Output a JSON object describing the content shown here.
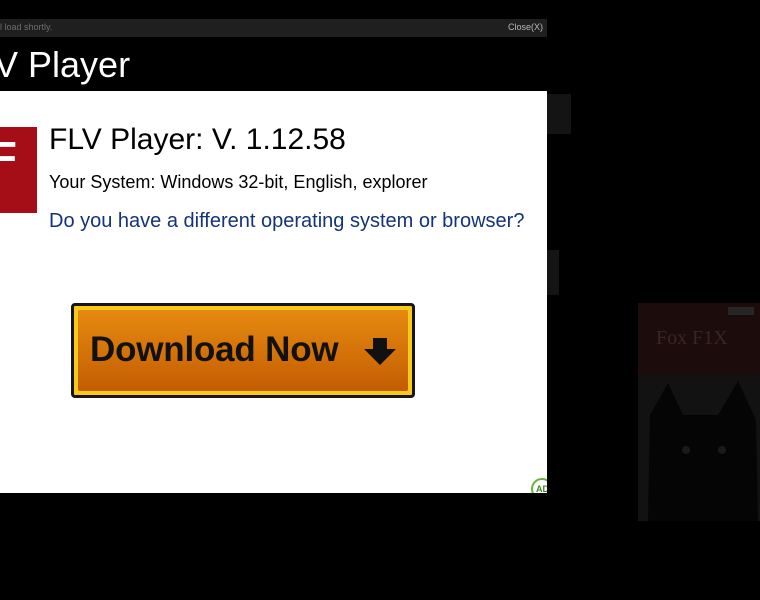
{
  "overlay": {
    "loading_text": "l load shortly.",
    "close_label": "Close(X)",
    "title": "V Player"
  },
  "dialog": {
    "icon_letter": "F",
    "headline": "FLV Player: V. 1.12.58",
    "system_info": "Your System: Windows 32-bit, English, explorer",
    "other_os_link": "Do you have a different operating system or browser?",
    "download_button_label": "Download Now",
    "ad_badge": "AD"
  },
  "background": {
    "thumbnail_title": "Fox F1X"
  },
  "colors": {
    "link_blue": "#13337a",
    "button_orange": "#d97a0a",
    "button_border": "#f8c81a",
    "icon_red": "#a50e16"
  },
  "icons": [
    "down-arrow-icon",
    "ad-choices-icon",
    "cat-silhouette-image"
  ]
}
